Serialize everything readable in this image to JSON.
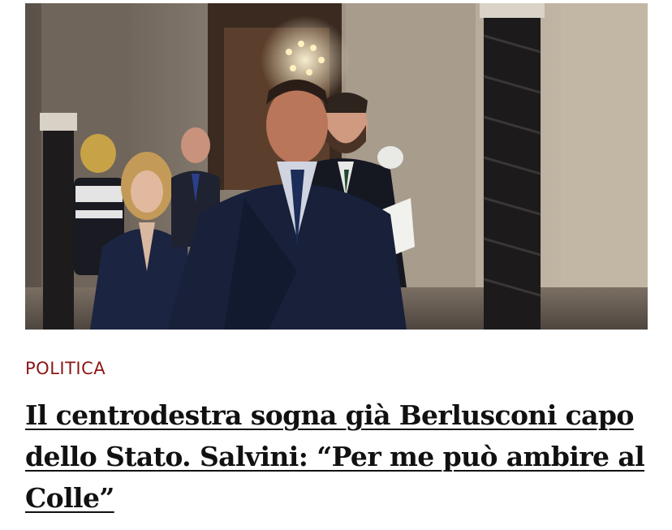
{
  "article": {
    "image_alt": "Politicians walking through a palace hallway",
    "category": "POLITICA",
    "headline": "Il centrodestra sogna già Berlusconi capo dello Stato. Salvini: “Per me può ambire al Colle”"
  },
  "colors": {
    "category": "#8a1717",
    "headline": "#111111",
    "background": "#ffffff"
  }
}
